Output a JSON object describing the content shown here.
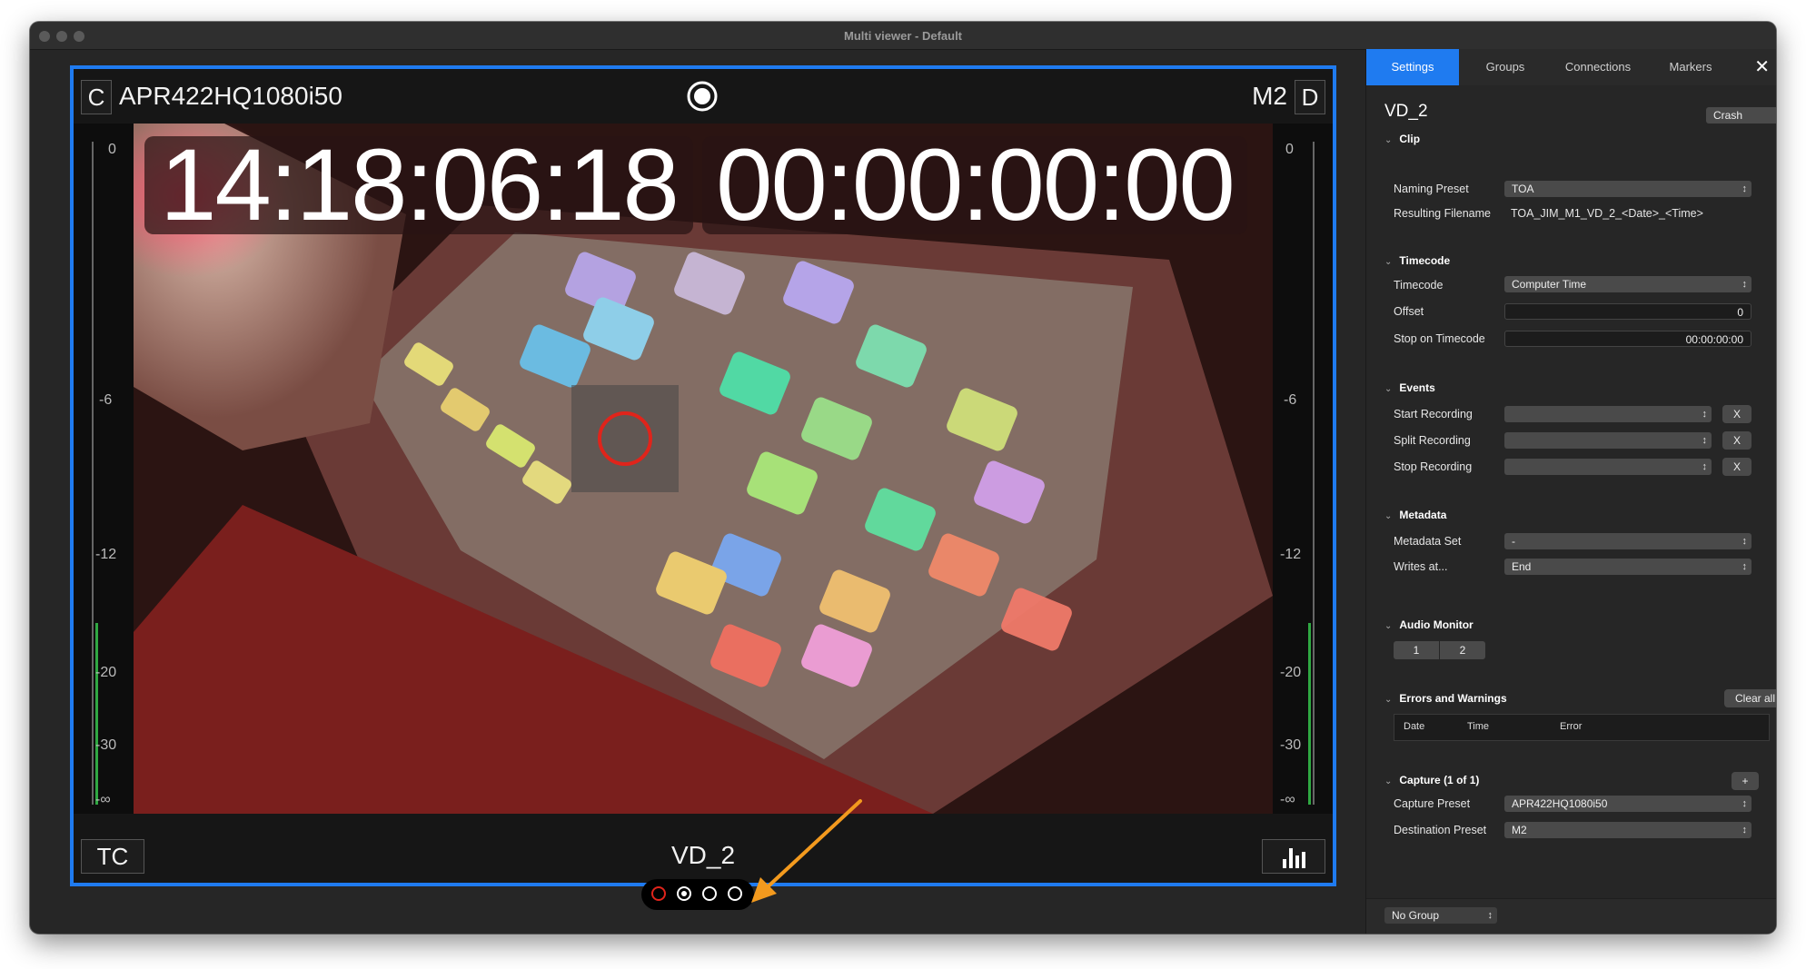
{
  "window": {
    "title": "Multi viewer - Default"
  },
  "viewer": {
    "left_badge": "C",
    "source_name": "APR422HQ1080i50",
    "destination": "M2",
    "right_badge": "D",
    "timecode_time": "14:18:06:18",
    "timecode_elapsed": "00:00:00:00",
    "tc_button": "TC",
    "channel_name": "VD_2",
    "meter_scale": [
      "0",
      "-6",
      "-12",
      "-20",
      "-30",
      "-∞"
    ]
  },
  "sidebar": {
    "tabs": [
      "Settings",
      "Groups",
      "Connections",
      "Markers"
    ],
    "title": "VD_2",
    "mode_select": "Crash",
    "clip": {
      "header": "Clip",
      "naming_preset_label": "Naming Preset",
      "naming_preset_value": "TOA",
      "resulting_filename_label": "Resulting Filename",
      "resulting_filename_value": "TOA_JIM_M1_VD_2_<Date>_<Time>"
    },
    "timecode": {
      "header": "Timecode",
      "timecode_label": "Timecode",
      "timecode_value": "Computer Time",
      "offset_label": "Offset",
      "offset_value": "0",
      "stop_label": "Stop on Timecode",
      "stop_value": "00:00:00:00"
    },
    "events": {
      "header": "Events",
      "start_label": "Start Recording",
      "split_label": "Split Recording",
      "stop_label": "Stop Recording",
      "clear_label": "X"
    },
    "metadata": {
      "header": "Metadata",
      "set_label": "Metadata Set",
      "set_value": "-",
      "writes_label": "Writes at...",
      "writes_value": "End"
    },
    "audio": {
      "header": "Audio Monitor",
      "ch1": "1",
      "ch2": "2"
    },
    "errors": {
      "header": "Errors and Warnings",
      "clear_all": "Clear all",
      "col_date": "Date",
      "col_time": "Time",
      "col_error": "Error"
    },
    "capture": {
      "header": "Capture (1 of 1)",
      "add": "+",
      "capture_label": "Capture Preset",
      "capture_value": "APR422HQ1080i50",
      "destination_label": "Destination Preset",
      "destination_value": "M2"
    },
    "group_select": "No Group"
  },
  "colors": {
    "accent": "#1f7bf0",
    "record": "#e0241b",
    "annotation_arrow": "#f39a1e"
  }
}
